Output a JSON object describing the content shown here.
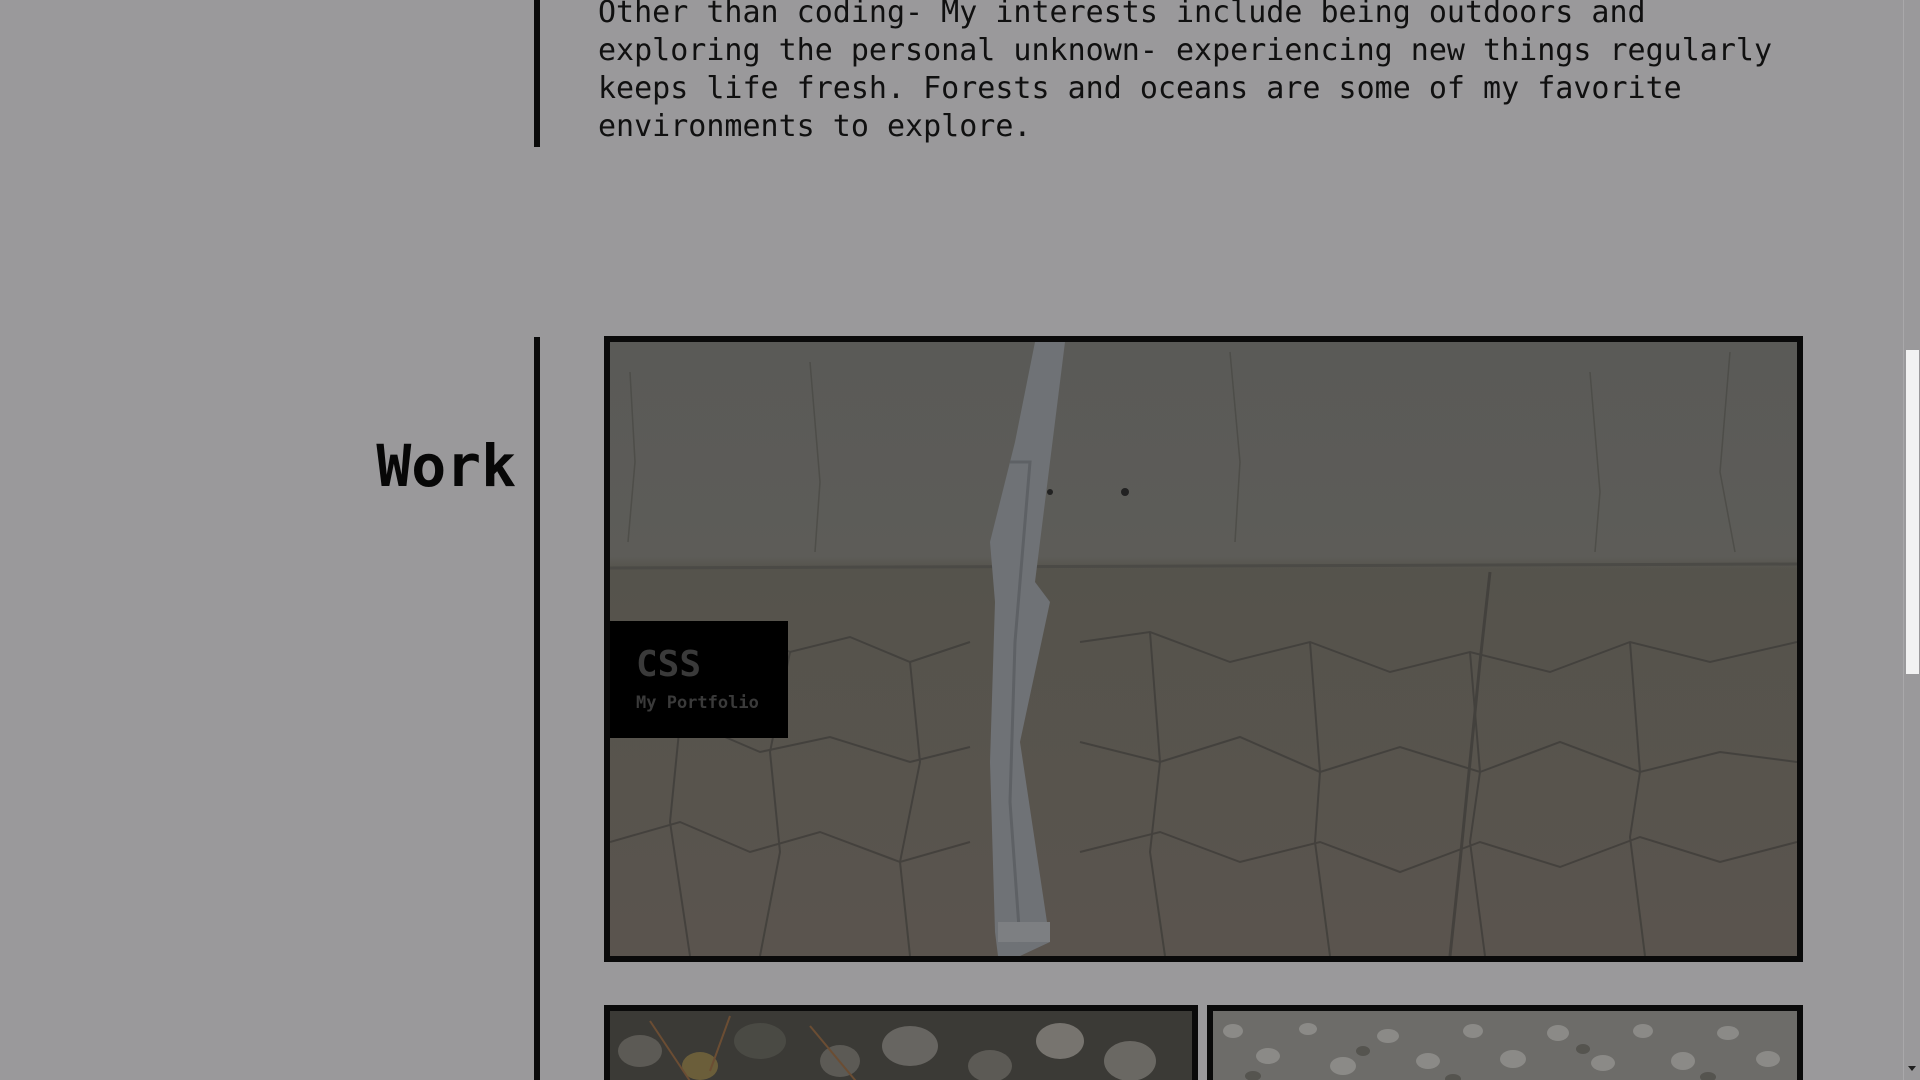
{
  "about": {
    "text": "Other than coding- My interests include being outdoors and exploring the personal unknown- experiencing new things regularly keeps life fresh. Forests and oceans are some of my favorite environments to explore."
  },
  "work": {
    "title": "Work",
    "featured": {
      "title": "CSS",
      "subtitle": "My Portfolio"
    }
  },
  "colors": {
    "background": "#9a999b",
    "divider": "#0a0a0a",
    "label_background": "#000000",
    "label_text": "#3a3a3a"
  }
}
